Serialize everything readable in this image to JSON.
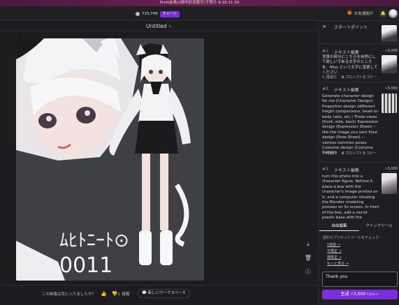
{
  "banner": "PixAI会員(3周年記念割引)で残り 9:18:11:39",
  "credits": {
    "amount": "715,749",
    "charge_label": "チャージ"
  },
  "header": {
    "friend_label": "お友達紹介"
  },
  "canvas": {
    "title": "Untitled",
    "feedback_question": "この画像は気に入りましたか？",
    "post_label": "投稿",
    "new_workspace_label": "新しいワークスペース",
    "artwork_text_line1": "ﾑﾋﾄﾆｰﾄ⊙",
    "artwork_text_line2": "0011"
  },
  "sidebar": {
    "start_label": "スタートポイント",
    "history": [
      {
        "num": "#1",
        "tag": "テキスト編集",
        "cost": "3,000",
        "text": "背景の部分にこちらを自然にして欲しいである文字のところを、Miss という文字に変更してください",
        "actions": [
          "再試行",
          "プロンプトをコピー"
        ]
      },
      {
        "num": "#2",
        "tag": "テキスト編集",
        "cost": "3,000",
        "text": "Generate character design for me (Character Design): Proportion design (different height comparisons, head-to-body ratio, etc.) Three views (front, side, back) Expression design (Expression Sheet) -- like the image you sent Pose design (Pose Sheet) -- various common poses Costume design (Costume Design)",
        "actions": [
          "再試行",
          "プロンプトをコピー"
        ]
      },
      {
        "num": "#3",
        "tag": "テキスト編集",
        "cost": "3,000",
        "text": "turn this photo into a character figure. Behind it, place a box with the character's image printed on it, and a computer showing the Blender modeling process on its screen. In front of the box, add a round plastic base with the character figure standing on it. set the scene"
      }
    ],
    "tabs": [
      "自由編集",
      "クイックツール"
    ],
    "reco_label": "便利なプリセットツールをチェック：",
    "reco_items": [
      "1枚絵 →",
      "不規正 →",
      "通常正 →",
      "もっと見る →"
    ],
    "input_value": "Thank you",
    "generate_label": "生成",
    "generate_cost": "3,000",
    "generate_key": "Ctrl+↵"
  }
}
